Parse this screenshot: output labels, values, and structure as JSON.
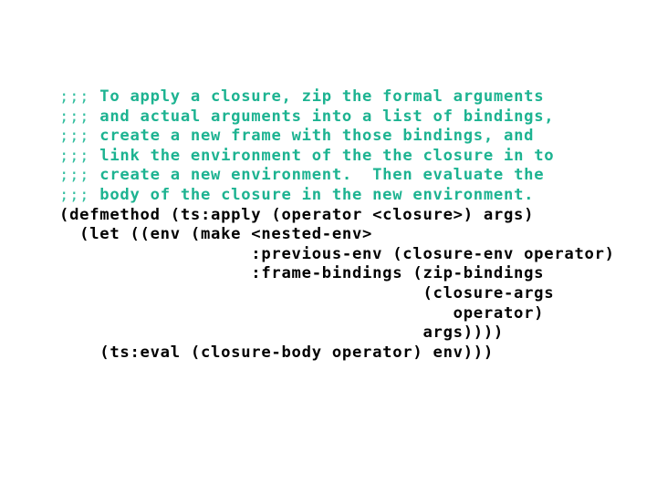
{
  "slide": {
    "background_color": "#ffffff",
    "comment_color": "#1DB391",
    "code_color": "#000000",
    "language": "lisp"
  },
  "code": {
    "lines": [
      {
        "kind": "comment",
        "semis": ";;;",
        "text": " To apply a closure, zip the formal arguments"
      },
      {
        "kind": "comment",
        "semis": ";;;",
        "text": " and actual arguments into a list of bindings,"
      },
      {
        "kind": "comment",
        "semis": ";;;",
        "text": " create a new frame with those bindings, and"
      },
      {
        "kind": "comment",
        "semis": ";;;",
        "text": " link the environment of the the closure in to"
      },
      {
        "kind": "comment",
        "semis": ";;;",
        "text": " create a new environment.  Then evaluate the"
      },
      {
        "kind": "comment",
        "semis": ";;;",
        "text": " body of the closure in the new environment."
      },
      {
        "kind": "code",
        "text": "(defmethod (ts:apply (operator <closure>) args)"
      },
      {
        "kind": "code",
        "text": "  (let ((env (make <nested-env>"
      },
      {
        "kind": "code",
        "text": "                   :previous-env (closure-env operator)"
      },
      {
        "kind": "code",
        "text": "                   :frame-bindings (zip-bindings"
      },
      {
        "kind": "code",
        "text": "                                    (closure-args"
      },
      {
        "kind": "code",
        "text": "                                       operator)"
      },
      {
        "kind": "code",
        "text": "                                    args))))"
      },
      {
        "kind": "code",
        "text": "    (ts:eval (closure-body operator) env)))"
      }
    ]
  }
}
